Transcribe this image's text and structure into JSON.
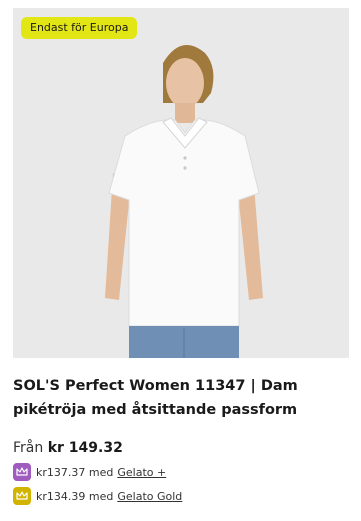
{
  "product": {
    "badge": "Endast för Europa",
    "image_alt": "Woman wearing white polo shirt",
    "title": "SOL'S Perfect Women 11347 | Dam pikétröja med åtsittande passform",
    "from_label": "Från",
    "price": "kr 149.32",
    "memberships": [
      {
        "price": "kr137.37",
        "with": "med",
        "plan": "Gelato +",
        "icon": "crown-icon",
        "color": "#a05bbf"
      },
      {
        "price": "kr134.39",
        "with": "med",
        "plan": "Gelato Gold",
        "icon": "crown-icon",
        "color": "#d0b400"
      }
    ]
  }
}
